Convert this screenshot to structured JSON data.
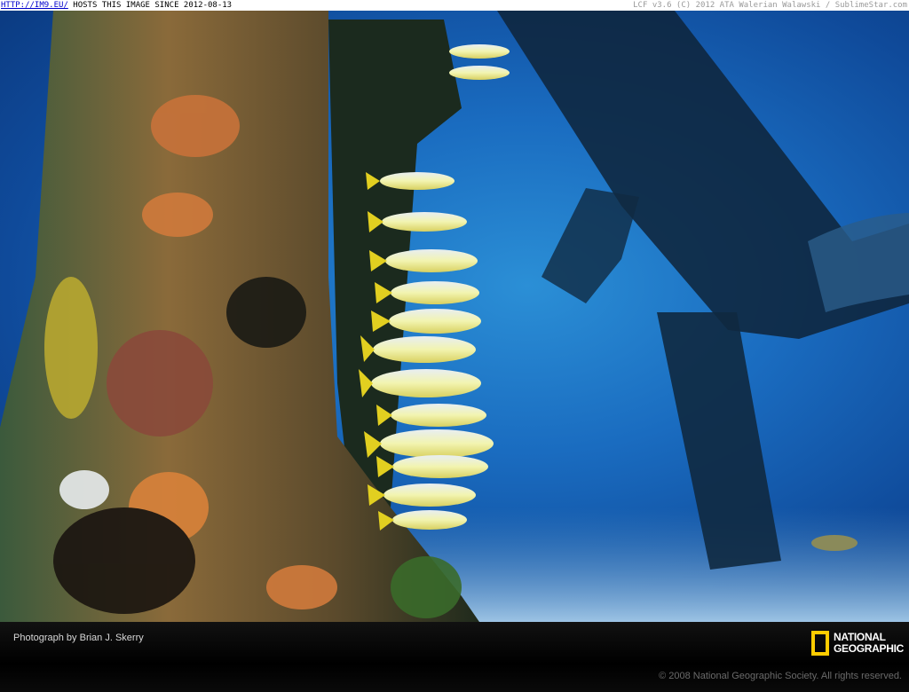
{
  "top_bar": {
    "host_link": "HTTP://IM9.EU/",
    "host_text": " HOSTS THIS IMAGE SINCE 2012-08-13",
    "credit": "LCF v3.6 (C) 2012 ATA Walerian Walawski / SublimeStar.com"
  },
  "caption": {
    "photographer": "Photograph by Brian J. Skerry",
    "copyright": "© 2008 National Geographic Society. All rights reserved."
  },
  "logo": {
    "line1": "NATIONAL",
    "line2": "GEOGRAPHIC",
    "frame_color": "#ffcc00"
  },
  "photo": {
    "subject": "school of yellow-striped fish beside coral-encrusted underwater pier pilings",
    "water_color": "#1a6cc0"
  }
}
